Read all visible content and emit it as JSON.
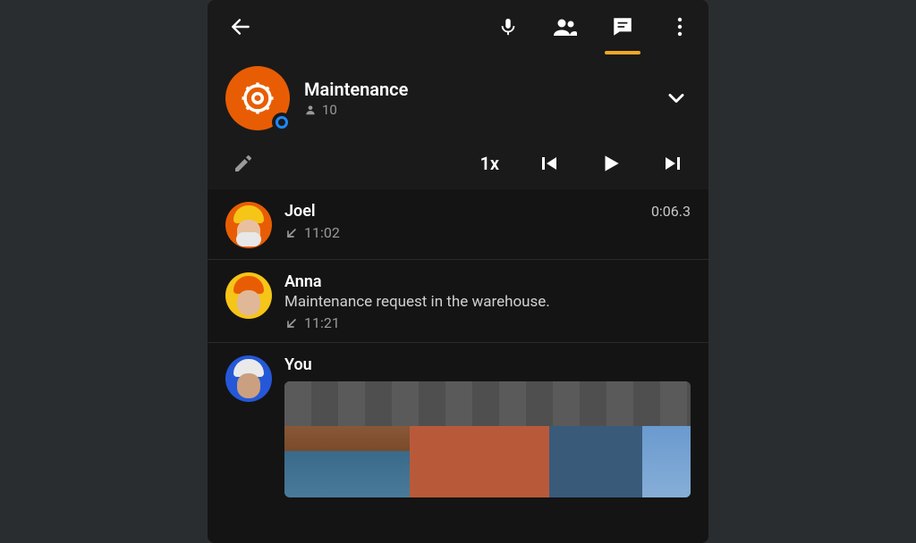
{
  "channel": {
    "name": "Maintenance",
    "member_count": "10"
  },
  "playback": {
    "speed": "1x"
  },
  "messages": [
    {
      "name": "Joel",
      "time": "11:02",
      "duration": "0:06.3"
    },
    {
      "name": "Anna",
      "text": "Maintenance request in the warehouse.",
      "time": "11:21"
    },
    {
      "name": "You"
    }
  ]
}
